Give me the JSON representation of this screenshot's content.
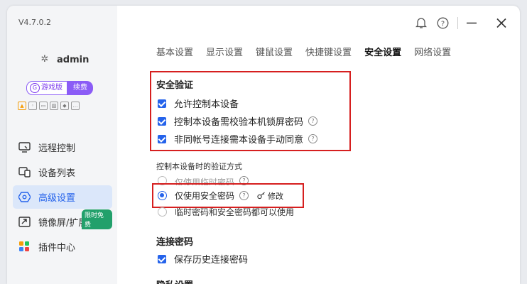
{
  "app": {
    "version": "V4.7.0.2"
  },
  "user": {
    "name": "admin"
  },
  "edition": {
    "label": "游戏版",
    "renew": "续费"
  },
  "sidebar": {
    "items": [
      {
        "label": "远程控制",
        "icon": "remote-control-icon"
      },
      {
        "label": "设备列表",
        "icon": "device-list-icon"
      },
      {
        "label": "高级设置",
        "icon": "advanced-settings-icon"
      },
      {
        "label": "镜像屏/扩展屏",
        "icon": "mirror-screen-icon",
        "badge": "限时免费"
      },
      {
        "label": "插件中心",
        "icon": "plugin-center-icon"
      }
    ],
    "active_index": 2
  },
  "tabs": [
    "基本设置",
    "显示设置",
    "键鼠设置",
    "快捷键设置",
    "安全设置",
    "网络设置"
  ],
  "active_tab": "安全设置",
  "security": {
    "title": "安全验证",
    "options": [
      {
        "label": "允许控制本设备",
        "checked": true
      },
      {
        "label": "控制本设备需校验本机锁屏密码",
        "checked": true
      },
      {
        "label": "非同帐号连接需本设备手动同意",
        "checked": true
      }
    ]
  },
  "verify": {
    "title": "控制本设备时的验证方式",
    "options": [
      {
        "label": "仅使用临时密码",
        "selected": false
      },
      {
        "label": "仅使用安全密码",
        "selected": true
      },
      {
        "label": "临时密码和安全密码都可以使用",
        "selected": false
      }
    ],
    "modify_label": "修改"
  },
  "conn_password": {
    "title": "连接密码",
    "option": "保存历史连接密码"
  },
  "privacy": {
    "title": "隐私设置"
  },
  "colors": {
    "accent": "#2563eb",
    "highlight_box": "#d61f1f",
    "edition": "#8b5cf6",
    "badge": "#22a06b"
  }
}
